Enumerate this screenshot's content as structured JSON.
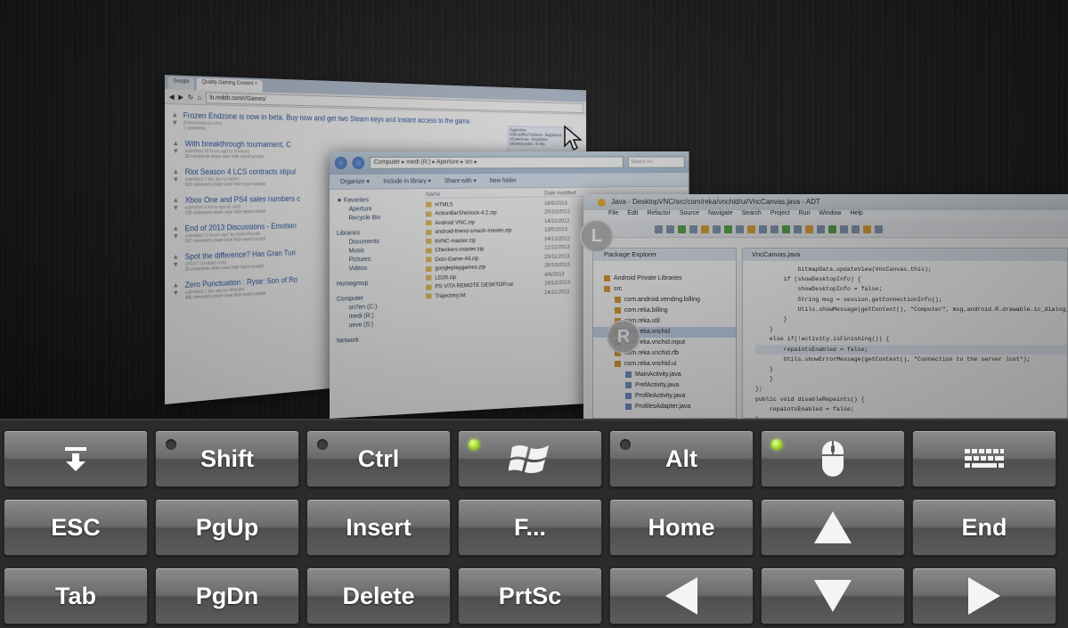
{
  "remote_screen": {
    "browser": {
      "tabs": [
        "Google",
        "Quality Gaming Content ×"
      ],
      "url": "lo.reddit.com/r/Games/",
      "posts": [
        {
          "title": "Frozen Endzone is now in beta. Buy now and get two Steam keys and instant access to the game.",
          "meta": "(frozenendzone.com)",
          "actions": "1 comments"
        },
        {
          "title": "With breakthrough tournament, C",
          "meta": "submitted 18 hours ago by thewiard",
          "actions": "33 comments share save hide report pocket"
        },
        {
          "title": "Riot Season 4 LCS contracts stipul",
          "meta": "submitted 1 day ago by tastes",
          "actions": "553 comments share save hide report pocket"
        },
        {
          "title": "Xbox One and PS4 sales numbers c",
          "meta": "submitted 4 hours ago by ukd2",
          "actions": "199 comments share save hide report pocket"
        },
        {
          "title": "End of 2013 Discussions - Emotion",
          "meta": "submitted 13 hours ago* by GamerNoodle",
          "actions": "187 comments share save hide report pocket"
        },
        {
          "title": "Spot the difference? Has Gran Turi",
          "meta": "(2010)? (youtube.com)",
          "actions": "25 comments share save hide report pocket"
        },
        {
          "title": "Zero Punctuation : Ryse: Son of Ro",
          "meta": "submitted 1 day ago by ethanakk",
          "actions": "385 comments share save hide report pocket"
        }
      ],
      "sidebar": [
        "Suggestions",
        "/r/ShouldIBuyThisGame - Suggestions",
        "/r/GameDeals - Deals/Sales",
        "/r/tipofmyjoystick - ID Help"
      ]
    },
    "explorer": {
      "path": "Computer ▸ medi (R:) ▸ Aperture ▸ src ▸",
      "search": "Search src",
      "toolbar": [
        "Organize ▾",
        "Include in library ▾",
        "Share with ▾",
        "New folder"
      ],
      "nav": {
        "favorites": "Favorites",
        "aperture": "Aperture",
        "recycle": "Recycle Bin",
        "libraries": "Libraries",
        "documents": "Documents",
        "music": "Music",
        "pictures": "Pictures",
        "videos": "Videos",
        "homegroup": "Homegroup",
        "computer": "Computer",
        "drive_c": "sn7en (C:)",
        "drive_r": "medi (R:)",
        "drive_s": "ueve (S:)",
        "network": "Network"
      },
      "columns": {
        "name": "Name",
        "date": "Date modified"
      },
      "files": [
        {
          "name": "HTML5",
          "date": "18/9/2013"
        },
        {
          "name": "ActionBarSherlock-4.2.zip",
          "date": "25/10/2012"
        },
        {
          "name": "Android VNC.zip",
          "date": "14/11/2012"
        },
        {
          "name": "android-friend-smash-master.zip",
          "date": "13/5/2013"
        },
        {
          "name": "bVNC-master.zip",
          "date": "24/12/2012"
        },
        {
          "name": "Checkers-master.zip",
          "date": "12/11/2013"
        },
        {
          "name": "Dots-Game-All.zip",
          "date": "25/11/2013"
        },
        {
          "name": "googleplaygames.zip",
          "date": "28/10/2013"
        },
        {
          "name": "LD26.zip",
          "date": "4/6/2013"
        },
        {
          "name": "PS VITA REMOTE DESKTOP.rar",
          "date": "18/12/2013"
        },
        {
          "name": "Trajectory.txt",
          "date": "14/11/2012"
        }
      ]
    },
    "adt": {
      "title": "Java - DesktopVNC/src/com/reka/vnchid/ui/VncCanvas.java - ADT",
      "menu": [
        "File",
        "Edit",
        "Refactor",
        "Source",
        "Navigate",
        "Search",
        "Project",
        "Run",
        "Window",
        "Help"
      ],
      "package_explorer_title": "Package Explorer",
      "editor_tab": "VncCanvas.java",
      "tree": [
        {
          "label": "Android Private Libraries",
          "indent": 1,
          "icon": "lib"
        },
        {
          "label": "src",
          "indent": 1,
          "icon": "src"
        },
        {
          "label": "com.android.vending.billing",
          "indent": 2,
          "icon": "pkg"
        },
        {
          "label": "com.reka.billing",
          "indent": 2,
          "icon": "pkg"
        },
        {
          "label": "com.reka.util",
          "indent": 2,
          "icon": "pkg"
        },
        {
          "label": "com.reka.vnchid",
          "indent": 2,
          "icon": "pkg",
          "selected": true
        },
        {
          "label": "com.reka.vnchid.input",
          "indent": 2,
          "icon": "pkg"
        },
        {
          "label": "com.reka.vnchid.rfb",
          "indent": 2,
          "icon": "pkg"
        },
        {
          "label": "com.reka.vnchid.ui",
          "indent": 2,
          "icon": "pkg"
        },
        {
          "label": "MainActivity.java",
          "indent": 3,
          "icon": "java"
        },
        {
          "label": "PrefActivity.java",
          "indent": 3,
          "icon": "java"
        },
        {
          "label": "ProfileActivity.java",
          "indent": 3,
          "icon": "java"
        },
        {
          "label": "ProfilesAdapter.java",
          "indent": 3,
          "icon": "java"
        }
      ],
      "code": [
        "            bitmapData.updateView(VncCanvas.this);",
        "        if (showDesktopInfo) {",
        "            showDesktopInfo = false;",
        "            String msg = session.getConnectionInfo();",
        "            Utils.showMessage(getContext(), \"Computer\", msg,android.R.drawable.ic_dialog_info);",
        "        }",
        "    }",
        "    else if(!activity.isFinishing()) {",
        "        repaintsEnabled = false;",
        "        Utils.showErrorMessage(getContext(), \"Connection to the server lost\");",
        "    }",
        "    }",
        "};",
        "",
        "public void disableRepaints() {",
        "    repaintsEnabled = false;",
        "}"
      ]
    },
    "markers": {
      "left": "L",
      "right": "R"
    }
  },
  "keyboard": {
    "rows": [
      [
        {
          "id": "hide",
          "label": "",
          "icon": "arrow-down-to-line-icon"
        },
        {
          "id": "shift",
          "label": "Shift",
          "led": "off"
        },
        {
          "id": "ctrl",
          "label": "Ctrl",
          "led": "off"
        },
        {
          "id": "win",
          "label": "",
          "icon": "windows-logo-icon",
          "led": "on"
        },
        {
          "id": "alt",
          "label": "Alt",
          "led": "off"
        },
        {
          "id": "mouse",
          "label": "",
          "icon": "mouse-icon",
          "led": "on"
        },
        {
          "id": "keyboard",
          "label": "",
          "icon": "keyboard-icon"
        }
      ],
      [
        {
          "id": "esc",
          "label": "ESC"
        },
        {
          "id": "pgup",
          "label": "PgUp"
        },
        {
          "id": "insert",
          "label": "Insert"
        },
        {
          "id": "fkeys",
          "label": "F..."
        },
        {
          "id": "home",
          "label": "Home"
        },
        {
          "id": "up",
          "label": "",
          "icon": "arrow-up-icon"
        },
        {
          "id": "end",
          "label": "End"
        }
      ],
      [
        {
          "id": "tab",
          "label": "Tab"
        },
        {
          "id": "pgdn",
          "label": "PgDn"
        },
        {
          "id": "delete",
          "label": "Delete"
        },
        {
          "id": "prtsc",
          "label": "PrtSc"
        },
        {
          "id": "left",
          "label": "",
          "icon": "arrow-left-icon"
        },
        {
          "id": "down",
          "label": "",
          "icon": "arrow-down-icon"
        },
        {
          "id": "right",
          "label": "",
          "icon": "arrow-right-icon"
        }
      ]
    ],
    "colors": {
      "led_on": "#9bd21e",
      "key_top": "#8b8b8b",
      "key_bottom": "#4f4f4f"
    }
  }
}
